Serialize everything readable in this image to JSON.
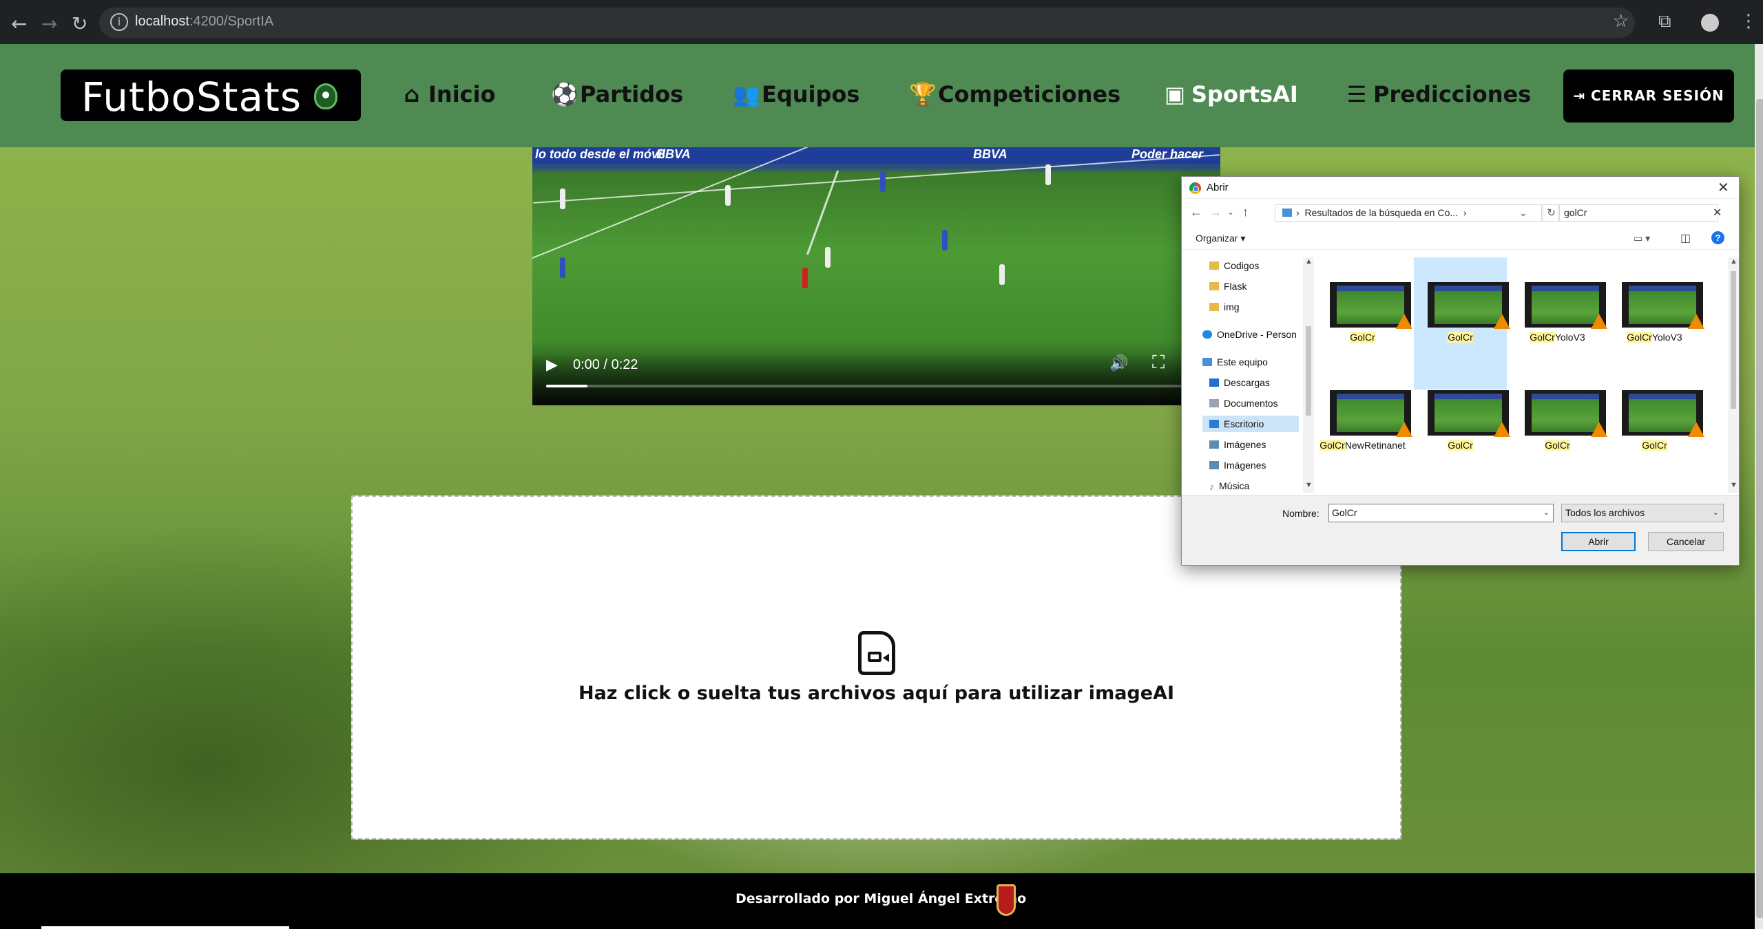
{
  "browser": {
    "url_host": "localhost",
    "url_path": ":4200/SportIA"
  },
  "header": {
    "logo": "FutboStats",
    "nav": [
      {
        "label": "Inicio",
        "icon": "home-icon"
      },
      {
        "label": "Partidos",
        "icon": "soccer-ball-icon"
      },
      {
        "label": "Equipos",
        "icon": "users-icon"
      },
      {
        "label": "Competiciones",
        "icon": "trophy-icon"
      },
      {
        "label": "SportsAI",
        "icon": "ai-icon",
        "active": true
      },
      {
        "label": "Predicciones",
        "icon": "bars-icon"
      }
    ],
    "logout": "CERRAR SESIÓN"
  },
  "video": {
    "time": "0:00 / 0:22",
    "progress": 0.063,
    "ads": [
      "lo todo desde el móvil",
      "BBVA",
      "BBVA",
      "Poder hacer"
    ]
  },
  "dropzone": {
    "text": "Haz click o suelta tus archivos aquí para utilizar imageAI"
  },
  "footer": {
    "text": "Desarrollado por Miguel Ángel Extremo"
  },
  "dialog": {
    "title": "Abrir",
    "address": "Resultados de la búsqueda en Co...",
    "search_value": "golCr",
    "organize": "Organizar",
    "tree": [
      {
        "label": "Codigos",
        "icon": "folder-icon"
      },
      {
        "label": "Flask",
        "icon": "folder-icon"
      },
      {
        "label": "img",
        "icon": "folder-icon"
      },
      {
        "label": "OneDrive - Person",
        "icon": "cloud-icon"
      },
      {
        "label": "Este equipo",
        "icon": "computer-icon"
      },
      {
        "label": "Descargas",
        "icon": "download-icon"
      },
      {
        "label": "Documentos",
        "icon": "document-icon"
      },
      {
        "label": "Escritorio",
        "icon": "desktop-icon",
        "selected": true
      },
      {
        "label": "Imágenes",
        "icon": "image-icon"
      },
      {
        "label": "Imágenes",
        "icon": "image-icon"
      },
      {
        "label": "Música",
        "icon": "music-icon"
      }
    ],
    "files": [
      {
        "pre": "",
        "hl": "GolCr",
        "post": "",
        "selected": false
      },
      {
        "pre": "",
        "hl": "GolCr",
        "post": "",
        "selected": true
      },
      {
        "pre": "",
        "hl": "GolCr",
        "post": "YoloV3",
        "selected": false
      },
      {
        "pre": "",
        "hl": "GolCr",
        "post": "YoloV3",
        "selected": false
      },
      {
        "pre": "",
        "hl": "GolCr",
        "post": "NewRetinanet",
        "selected": false
      },
      {
        "pre": "",
        "hl": "GolCr",
        "post": "",
        "selected": false
      },
      {
        "pre": "",
        "hl": "GolCr",
        "post": "",
        "selected": false
      },
      {
        "pre": "",
        "hl": "GolCr",
        "post": "",
        "selected": false
      }
    ],
    "name_label": "Nombre:",
    "name_value": "GolCr",
    "filter": "Todos los archivos",
    "open": "Abrir",
    "cancel": "Cancelar"
  }
}
